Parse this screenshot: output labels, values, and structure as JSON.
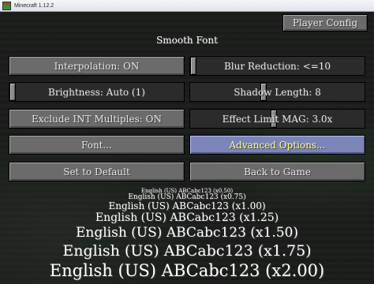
{
  "window": {
    "title": "Minecraft 1.12.2"
  },
  "screen_title": "Smooth Font",
  "player_config_label": "Player Config",
  "buttons": {
    "interpolation": "Interpolation: ON",
    "exclude_int": "Exclude INT Multiples: ON",
    "font": "Font...",
    "set_default": "Set to Default",
    "advanced": "Advanced Options...",
    "back": "Back to Game"
  },
  "sliders": {
    "blur": {
      "label": "Blur Reduction: <=10",
      "value": 0.0
    },
    "brightness": {
      "label": "Brightness: Auto (1)",
      "value": 0.0
    },
    "shadow": {
      "label": "Shadow Length: 8",
      "value": 0.42
    },
    "effect": {
      "label": "Effect Limit MAG: 3.0x",
      "value": 0.48
    }
  },
  "samples": [
    {
      "text": "English (US) ABCabc123 (x0.50)",
      "scale": 0.5
    },
    {
      "text": "English (US) ABCabc123 (x0.75)",
      "scale": 0.75
    },
    {
      "text": "English (US) ABCabc123 (x1.00)",
      "scale": 1.0
    },
    {
      "text": "English (US) ABCabc123 (x1.25)",
      "scale": 1.25
    },
    {
      "text": "English (US) ABCabc123 (x1.50)",
      "scale": 1.5
    },
    {
      "text": "English (US) ABCabc123 (x1.75)",
      "scale": 1.75
    },
    {
      "text": "English (US) ABCabc123 (x2.00)",
      "scale": 2.0
    }
  ],
  "hover_button": "advanced"
}
